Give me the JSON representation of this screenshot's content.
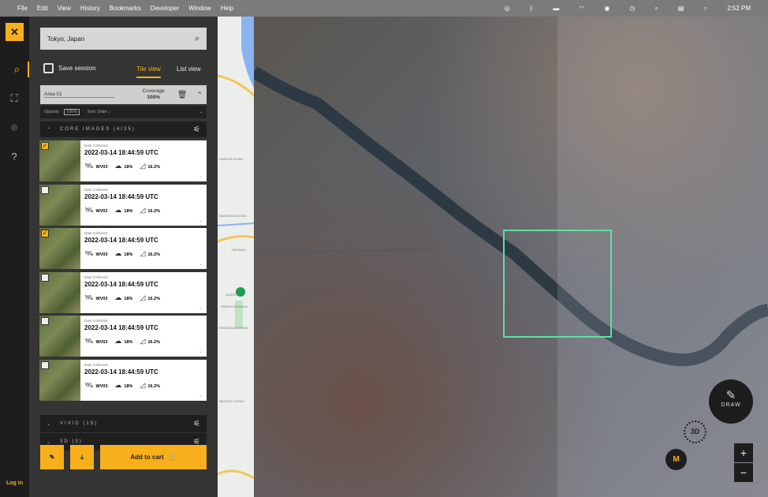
{
  "menubar": {
    "items": [
      "File",
      "Edit",
      "View",
      "History",
      "Bookmarks",
      "Developer",
      "Window",
      "Help"
    ],
    "time": "2:52 PM"
  },
  "rail": {
    "logo": "✕",
    "login": "Log in"
  },
  "search": {
    "value": "Tokyo, Japan"
  },
  "toolbar": {
    "save": "Save session",
    "tile": "Tile view",
    "list": "List view"
  },
  "area": {
    "name": "Area 01",
    "coverage_label": "Coverage",
    "coverage": "100%"
  },
  "options": {
    "opacity_label": "Opacity",
    "opacity": "100%",
    "sort": "Sort: Date ↓"
  },
  "sections": {
    "core": "CORE IMAGES (4/35)",
    "vivid": "VIVID (15)",
    "three_d": "3D (3)"
  },
  "images": [
    {
      "checked": true,
      "label": "Date Collected",
      "date": "2022-03-14 18:44:59 UTC",
      "sensor": "WV03",
      "cloud": "18%",
      "angle": "16.2%"
    },
    {
      "checked": false,
      "label": "Date Collected",
      "date": "2022-03-14 18:44:59 UTC",
      "sensor": "WV03",
      "cloud": "18%",
      "angle": "16.2%"
    },
    {
      "checked": true,
      "label": "Date Collected",
      "date": "2022-03-14 18:44:59 UTC",
      "sensor": "WV03",
      "cloud": "18%",
      "angle": "16.2%"
    },
    {
      "checked": false,
      "label": "Date Collected",
      "date": "2022-03-14 18:44:59 UTC",
      "sensor": "WV03",
      "cloud": "18%",
      "angle": "16.2%"
    },
    {
      "checked": false,
      "label": "Date Collected",
      "date": "2022-03-14 18:44:59 UTC",
      "sensor": "WV03",
      "cloud": "18%",
      "angle": "16.2%"
    },
    {
      "checked": false,
      "label": "Date Collected",
      "date": "2022-03-14 18:44:59 UTC",
      "sensor": "WV03",
      "cloud": "18%",
      "angle": "16.2%"
    }
  ],
  "actions": {
    "cart": "Add to cart"
  },
  "map": {
    "draw": "DRAW",
    "three_d": "3D",
    "mode": "M",
    "zoom_in": "+",
    "zoom_out": "−",
    "labels": [
      "DAEGOK-DONG",
      "BAEKSEOK-DONG",
      "GEOMAN",
      "SAJEONG",
      "SINHYEON-DONG",
      "SEONGNAM-DONG",
      "MICHEUL-DONG"
    ]
  },
  "colors": {
    "accent": "#f7b01b",
    "aoi": "#5fe0a0"
  }
}
